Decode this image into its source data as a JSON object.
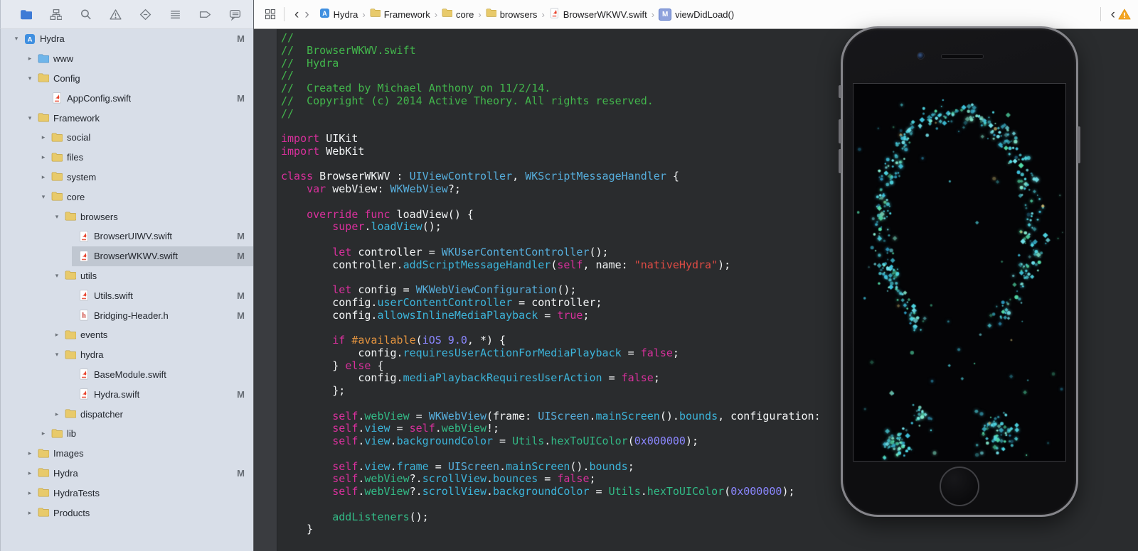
{
  "navigator_toolbar": {
    "items": [
      {
        "name": "project-navigator",
        "icon": "folder",
        "active": true
      },
      {
        "name": "symbol-navigator",
        "icon": "symbols",
        "active": false
      },
      {
        "name": "find-navigator",
        "icon": "search",
        "active": false
      },
      {
        "name": "issue-navigator",
        "icon": "warning",
        "active": false
      },
      {
        "name": "test-navigator",
        "icon": "diamond",
        "active": false
      },
      {
        "name": "debug-navigator",
        "icon": "lines",
        "active": false
      },
      {
        "name": "breakpoint-navigator",
        "icon": "flag",
        "active": false
      },
      {
        "name": "report-navigator",
        "icon": "bubble",
        "active": false
      }
    ]
  },
  "sidebar": {
    "rows": [
      {
        "label": "Hydra",
        "icon": "project",
        "depth": 0,
        "disclosure": "open",
        "modified": "M"
      },
      {
        "label": "www",
        "icon": "folder-blue",
        "depth": 1,
        "disclosure": "closed"
      },
      {
        "label": "Config",
        "icon": "folder",
        "depth": 1,
        "disclosure": "open"
      },
      {
        "label": "AppConfig.swift",
        "icon": "swift",
        "depth": 2,
        "disclosure": "none",
        "modified": "M"
      },
      {
        "label": "Framework",
        "icon": "folder",
        "depth": 1,
        "disclosure": "open"
      },
      {
        "label": "social",
        "icon": "folder",
        "depth": 2,
        "disclosure": "closed"
      },
      {
        "label": "files",
        "icon": "folder",
        "depth": 2,
        "disclosure": "closed"
      },
      {
        "label": "system",
        "icon": "folder",
        "depth": 2,
        "disclosure": "closed"
      },
      {
        "label": "core",
        "icon": "folder",
        "depth": 2,
        "disclosure": "open"
      },
      {
        "label": "browsers",
        "icon": "folder",
        "depth": 3,
        "disclosure": "open"
      },
      {
        "label": "BrowserUIWV.swift",
        "icon": "swift",
        "depth": 4,
        "disclosure": "none",
        "modified": "M"
      },
      {
        "label": "BrowserWKWV.swift",
        "icon": "swift",
        "depth": 4,
        "disclosure": "none",
        "modified": "M",
        "selected": true
      },
      {
        "label": "utils",
        "icon": "folder",
        "depth": 3,
        "disclosure": "open"
      },
      {
        "label": "Utils.swift",
        "icon": "swift",
        "depth": 4,
        "disclosure": "none",
        "modified": "M"
      },
      {
        "label": "Bridging-Header.h",
        "icon": "header",
        "depth": 4,
        "disclosure": "none",
        "modified": "M"
      },
      {
        "label": "events",
        "icon": "folder",
        "depth": 3,
        "disclosure": "closed"
      },
      {
        "label": "hydra",
        "icon": "folder",
        "depth": 3,
        "disclosure": "open"
      },
      {
        "label": "BaseModule.swift",
        "icon": "swift",
        "depth": 4,
        "disclosure": "none"
      },
      {
        "label": "Hydra.swift",
        "icon": "swift",
        "depth": 4,
        "disclosure": "none",
        "modified": "M"
      },
      {
        "label": "dispatcher",
        "icon": "folder",
        "depth": 3,
        "disclosure": "closed"
      },
      {
        "label": "lib",
        "icon": "folder",
        "depth": 2,
        "disclosure": "closed"
      },
      {
        "label": "Images",
        "icon": "folder",
        "depth": 1,
        "disclosure": "closed"
      },
      {
        "label": "Hydra",
        "icon": "folder",
        "depth": 1,
        "disclosure": "closed",
        "modified": "M"
      },
      {
        "label": "HydraTests",
        "icon": "folder",
        "depth": 1,
        "disclosure": "closed"
      },
      {
        "label": "Products",
        "icon": "folder",
        "depth": 1,
        "disclosure": "closed"
      }
    ]
  },
  "jump_bar": {
    "crumbs": [
      {
        "icon": "app",
        "label": "Hydra"
      },
      {
        "icon": "folder",
        "label": "Framework"
      },
      {
        "icon": "folder",
        "label": "core"
      },
      {
        "icon": "folder",
        "label": "browsers"
      },
      {
        "icon": "swift",
        "label": "BrowserWKWV.swift"
      },
      {
        "icon": "method",
        "label": "viewDidLoad()"
      }
    ],
    "method_badge": "M"
  },
  "editor": {
    "lines": [
      [
        [
          "cmt",
          "//"
        ]
      ],
      [
        [
          "cmt",
          "//  BrowserWKWV.swift"
        ]
      ],
      [
        [
          "cmt",
          "//  Hydra"
        ]
      ],
      [
        [
          "cmt",
          "//"
        ]
      ],
      [
        [
          "cmt",
          "//  Created by Michael Anthony on 11/2/14."
        ]
      ],
      [
        [
          "cmt",
          "//  Copyright (c) 2014 Active Theory. All rights reserved."
        ]
      ],
      [
        [
          "cmt",
          "//"
        ]
      ],
      [],
      [
        [
          "kw",
          "import"
        ],
        [
          "pl",
          " UIKit"
        ]
      ],
      [
        [
          "kw",
          "import"
        ],
        [
          "pl",
          " WebKit"
        ]
      ],
      [],
      [
        [
          "kw",
          "class"
        ],
        [
          "pl",
          " BrowserWKWV : "
        ],
        [
          "type",
          "UIViewController"
        ],
        [
          "pl",
          ", "
        ],
        [
          "type",
          "WKScriptMessageHandler"
        ],
        [
          "pl",
          " {"
        ]
      ],
      [
        [
          "pl",
          "    "
        ],
        [
          "kw",
          "var"
        ],
        [
          "pl",
          " webView: "
        ],
        [
          "type",
          "WKWebView"
        ],
        [
          "pl",
          "?;"
        ]
      ],
      [],
      [
        [
          "pl",
          "    "
        ],
        [
          "kw",
          "override"
        ],
        [
          "pl",
          " "
        ],
        [
          "kw",
          "func"
        ],
        [
          "pl",
          " loadView() {"
        ]
      ],
      [
        [
          "pl",
          "        "
        ],
        [
          "kw",
          "super"
        ],
        [
          "pl",
          "."
        ],
        [
          "mem",
          "loadView"
        ],
        [
          "pl",
          "();"
        ]
      ],
      [],
      [
        [
          "pl",
          "        "
        ],
        [
          "kw",
          "let"
        ],
        [
          "pl",
          " controller = "
        ],
        [
          "type",
          "WKUserContentController"
        ],
        [
          "pl",
          "();"
        ]
      ],
      [
        [
          "pl",
          "        controller."
        ],
        [
          "mem",
          "addScriptMessageHandler"
        ],
        [
          "pl",
          "("
        ],
        [
          "kw",
          "self"
        ],
        [
          "pl",
          ", name: "
        ],
        [
          "str",
          "\"nativeHydra\""
        ],
        [
          "pl",
          ");"
        ]
      ],
      [],
      [
        [
          "pl",
          "        "
        ],
        [
          "kw",
          "let"
        ],
        [
          "pl",
          " config = "
        ],
        [
          "type",
          "WKWebViewConfiguration"
        ],
        [
          "pl",
          "();"
        ]
      ],
      [
        [
          "pl",
          "        config."
        ],
        [
          "mem",
          "userContentController"
        ],
        [
          "pl",
          " = controller;"
        ]
      ],
      [
        [
          "pl",
          "        config."
        ],
        [
          "mem",
          "allowsInlineMediaPlayback"
        ],
        [
          "pl",
          " = "
        ],
        [
          "kw",
          "true"
        ],
        [
          "pl",
          ";"
        ]
      ],
      [],
      [
        [
          "pl",
          "        "
        ],
        [
          "kw",
          "if"
        ],
        [
          "pl",
          " "
        ],
        [
          "dir",
          "#available"
        ],
        [
          "pl",
          "("
        ],
        [
          "num",
          "iOS 9.0"
        ],
        [
          "pl",
          ", *) {"
        ]
      ],
      [
        [
          "pl",
          "            config."
        ],
        [
          "mem",
          "requiresUserActionForMediaPlayback"
        ],
        [
          "pl",
          " = "
        ],
        [
          "kw",
          "false"
        ],
        [
          "pl",
          ";"
        ]
      ],
      [
        [
          "pl",
          "        } "
        ],
        [
          "kw",
          "else"
        ],
        [
          "pl",
          " {"
        ]
      ],
      [
        [
          "pl",
          "            config."
        ],
        [
          "mem",
          "mediaPlaybackRequiresUserAction"
        ],
        [
          "pl",
          " = "
        ],
        [
          "kw",
          "false"
        ],
        [
          "pl",
          ";"
        ]
      ],
      [
        [
          "pl",
          "        };"
        ]
      ],
      [],
      [
        [
          "pl",
          "        "
        ],
        [
          "kw",
          "self"
        ],
        [
          "pl",
          "."
        ],
        [
          "proj",
          "webView"
        ],
        [
          "pl",
          " = "
        ],
        [
          "type",
          "WKWebView"
        ],
        [
          "pl",
          "(frame: "
        ],
        [
          "type",
          "UIScreen"
        ],
        [
          "pl",
          "."
        ],
        [
          "mem",
          "mainScreen"
        ],
        [
          "pl",
          "()."
        ],
        [
          "mem",
          "bounds"
        ],
        [
          "pl",
          ", configuration:"
        ]
      ],
      [
        [
          "pl",
          "        "
        ],
        [
          "kw",
          "self"
        ],
        [
          "pl",
          "."
        ],
        [
          "mem",
          "view"
        ],
        [
          "pl",
          " = "
        ],
        [
          "kw",
          "self"
        ],
        [
          "pl",
          "."
        ],
        [
          "proj",
          "webView"
        ],
        [
          "pl",
          "!;"
        ]
      ],
      [
        [
          "pl",
          "        "
        ],
        [
          "kw",
          "self"
        ],
        [
          "pl",
          "."
        ],
        [
          "mem",
          "view"
        ],
        [
          "pl",
          "."
        ],
        [
          "mem",
          "backgroundColor"
        ],
        [
          "pl",
          " = "
        ],
        [
          "proj",
          "Utils"
        ],
        [
          "pl",
          "."
        ],
        [
          "proj",
          "hexToUIColor"
        ],
        [
          "pl",
          "("
        ],
        [
          "num",
          "0x000000"
        ],
        [
          "pl",
          ");"
        ]
      ],
      [],
      [
        [
          "pl",
          "        "
        ],
        [
          "kw",
          "self"
        ],
        [
          "pl",
          "."
        ],
        [
          "mem",
          "view"
        ],
        [
          "pl",
          "."
        ],
        [
          "mem",
          "frame"
        ],
        [
          "pl",
          " = "
        ],
        [
          "type",
          "UIScreen"
        ],
        [
          "pl",
          "."
        ],
        [
          "mem",
          "mainScreen"
        ],
        [
          "pl",
          "()."
        ],
        [
          "mem",
          "bounds"
        ],
        [
          "pl",
          ";"
        ]
      ],
      [
        [
          "pl",
          "        "
        ],
        [
          "kw",
          "self"
        ],
        [
          "pl",
          "."
        ],
        [
          "proj",
          "webView"
        ],
        [
          "pl",
          "?."
        ],
        [
          "mem",
          "scrollView"
        ],
        [
          "pl",
          "."
        ],
        [
          "mem",
          "bounces"
        ],
        [
          "pl",
          " = "
        ],
        [
          "kw",
          "false"
        ],
        [
          "pl",
          ";"
        ]
      ],
      [
        [
          "pl",
          "        "
        ],
        [
          "kw",
          "self"
        ],
        [
          "pl",
          "."
        ],
        [
          "proj",
          "webView"
        ],
        [
          "pl",
          "?."
        ],
        [
          "mem",
          "scrollView"
        ],
        [
          "pl",
          "."
        ],
        [
          "mem",
          "backgroundColor"
        ],
        [
          "pl",
          " = "
        ],
        [
          "proj",
          "Utils"
        ],
        [
          "pl",
          "."
        ],
        [
          "proj",
          "hexToUIColor"
        ],
        [
          "pl",
          "("
        ],
        [
          "num",
          "0x000000"
        ],
        [
          "pl",
          ");"
        ]
      ],
      [],
      [
        [
          "pl",
          "        "
        ],
        [
          "proj",
          "addListeners"
        ],
        [
          "pl",
          "();"
        ]
      ],
      [
        [
          "pl",
          "    }"
        ]
      ]
    ]
  },
  "colors": {
    "accent_blue": "#3E7BD6",
    "comment_green": "#42B64C",
    "keyword_magenta": "#D8309C",
    "string_red": "#DE4B44",
    "number_purple": "#8B87FF",
    "type_blue": "#56AEDC",
    "member_cyan": "#3CB4DA",
    "project_symbol_green": "#32BA86",
    "directive_orange": "#E0923F",
    "editor_bg": "#2A2C2E",
    "sidebar_bg": "#D8DEE8",
    "warning_yellow": "#F5A623",
    "particle_colors": [
      "#4fd6e2",
      "#3fc0da",
      "#74e4ec",
      "#53d9a6",
      "#86ecd0",
      "#2c93b8",
      "#c3b06e"
    ]
  },
  "phone": {
    "screen_content": "cyan-particle-arch"
  }
}
